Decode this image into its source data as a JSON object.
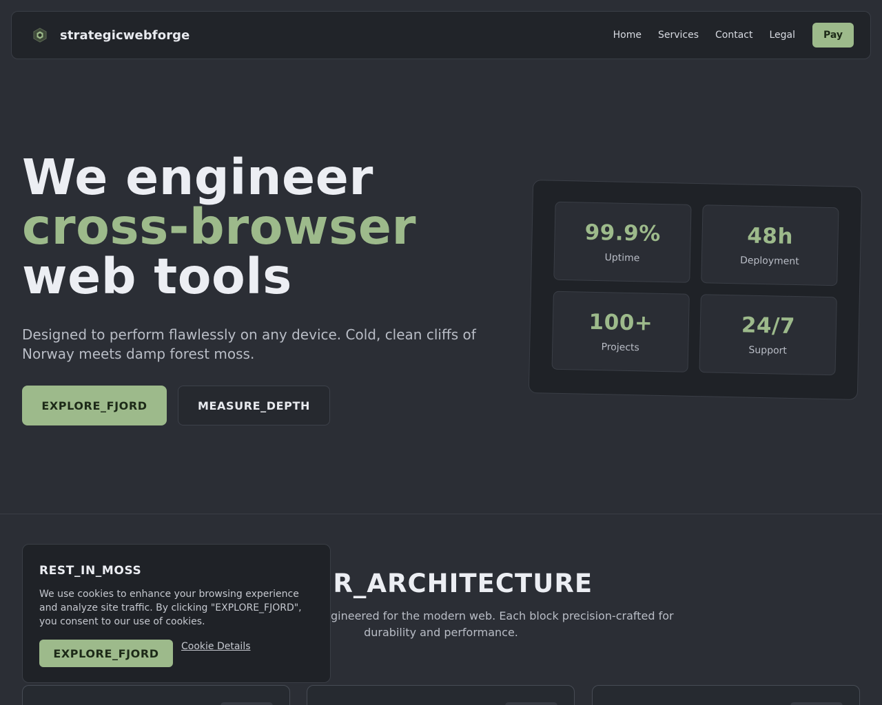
{
  "nav": {
    "brand": "strategicwebforge",
    "brand_icon": "hexagon-logo-icon",
    "links": [
      "Home",
      "Services",
      "Contact",
      "Legal"
    ],
    "cta": "Pay"
  },
  "hero": {
    "title_line1": "We engineer",
    "title_line2": "cross-browser",
    "title_line3": "web tools",
    "subtitle": "Designed to perform flawlessly on any device. Cold, clean cliffs of Norway meets damp forest moss.",
    "primary_button": "EXPLORE_FJORD",
    "secondary_button": "MEASURE_DEPTH"
  },
  "stats": [
    {
      "value": "99.9%",
      "label": "Uptime"
    },
    {
      "value": "48h",
      "label": "Deployment"
    },
    {
      "value": "100+",
      "label": "Projects"
    },
    {
      "value": "24/7",
      "label": "Support"
    }
  ],
  "section": {
    "title": "OUR_ARCHITECTURE",
    "subtitle": "Structural modules engineered for the modern web. Each block precision-crafted for durability and performance."
  },
  "cookie": {
    "title": "REST_IN_MOSS",
    "text": "We use cookies to enhance your browsing experience and analyze site traffic. By clicking \"EXPLORE_FJORD\", you consent to our use of cookies.",
    "accept": "EXPLORE_FJORD",
    "details": "Cookie Details"
  },
  "colors": {
    "background": "#2b2e35",
    "accent": "#9dba8b",
    "surface": "#1f2227"
  }
}
